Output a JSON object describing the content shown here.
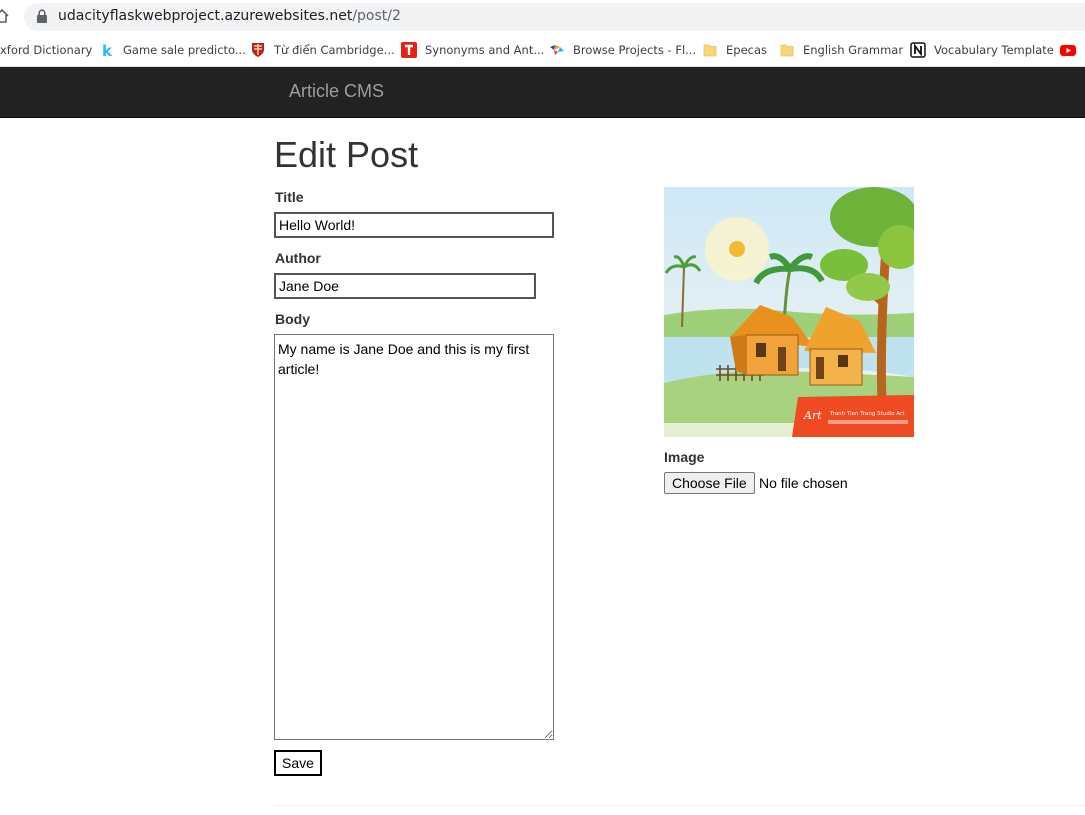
{
  "browser": {
    "url_host": "udacityflaskwebproject.azurewebsites.net",
    "url_path": "/post/2",
    "bookmarks": [
      {
        "label": "xford Dictionary",
        "icon": "none"
      },
      {
        "label": "Game sale predicto...",
        "icon": "kaggle-icon"
      },
      {
        "label": "Từ điển Cambridge...",
        "icon": "cambridge-shield-icon"
      },
      {
        "label": "Synonyms and Ant...",
        "icon": "thesaurus-icon"
      },
      {
        "label": "Browse Projects - Fl...",
        "icon": "freelancer-icon"
      },
      {
        "label": "Epecas",
        "icon": "folder-icon"
      },
      {
        "label": "English Grammar",
        "icon": "folder-icon"
      },
      {
        "label": "Vocabulary Template",
        "icon": "notion-icon"
      }
    ]
  },
  "navbar": {
    "brand": "Article CMS"
  },
  "page": {
    "title": "Edit Post"
  },
  "form": {
    "title_label": "Title",
    "title_value": "Hello World!",
    "author_label": "Author",
    "author_value": "Jane Doe",
    "body_label": "Body",
    "body_value": "My name is Jane Doe and this is my first article!",
    "image_label": "Image",
    "choose_file_label": "Choose File",
    "no_file_text": "No file chosen",
    "save_label": "Save"
  },
  "image": {
    "watermark_text": "Tranh Tien Trang Studio Art"
  },
  "colors": {
    "navbar_bg": "#222222",
    "brand": "#9d9d9d",
    "text": "#333333"
  }
}
